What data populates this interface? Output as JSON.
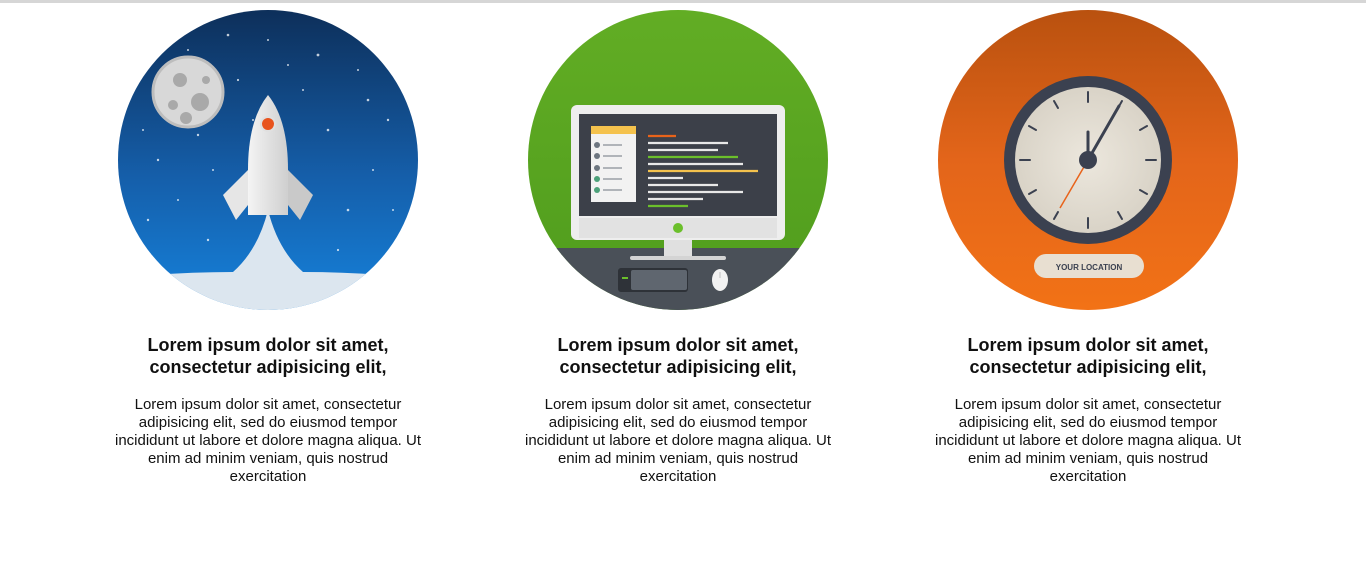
{
  "features": [
    {
      "illustration": "rocket-launch-illustration",
      "title": "Lorem ipsum dolor sit amet, consectetur adipisicing elit,",
      "text": "Lorem ipsum dolor sit amet, consectetur adipisicing elit, sed do eiusmod tempor incididunt ut labore et dolore magna aliqua. Ut enim ad minim veniam, quis nostrud exercitation",
      "color": "#1a6fc2"
    },
    {
      "illustration": "desktop-computer-illustration",
      "title": "Lorem ipsum dolor sit amet, consectetur adipisicing elit,",
      "text": "Lorem ipsum dolor sit amet, consectetur adipisicing elit, sed do eiusmod tempor incididunt ut labore et dolore magna aliqua. Ut enim ad minim veniam, quis nostrud exercitation",
      "color": "#5aa923"
    },
    {
      "illustration": "clock-illustration",
      "badge": "YOUR LOCATION",
      "title": "Lorem ipsum dolor sit amet, consectetur adipisicing elit,",
      "text": "Lorem ipsum dolor sit amet, consectetur adipisicing elit, sed do eiusmod tempor incididunt ut labore et dolore magna aliqua. Ut enim ad minim veniam, quis nostrud exercitation",
      "color": "#e8631a"
    }
  ]
}
